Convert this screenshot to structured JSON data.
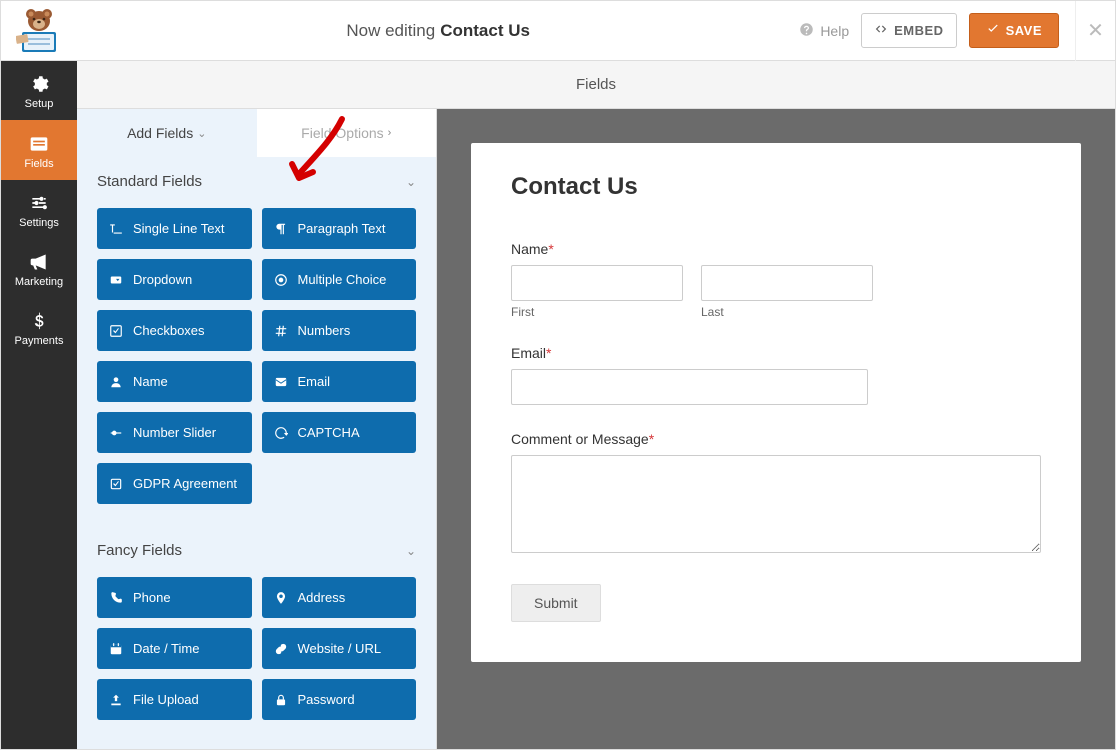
{
  "header": {
    "editing_prefix": "Now editing",
    "form_name": "Contact Us",
    "help_label": "Help",
    "embed_label": "EMBED",
    "save_label": "SAVE"
  },
  "sidenav": {
    "items": [
      {
        "id": "setup",
        "label": "Setup"
      },
      {
        "id": "fields",
        "label": "Fields"
      },
      {
        "id": "settings",
        "label": "Settings"
      },
      {
        "id": "marketing",
        "label": "Marketing"
      },
      {
        "id": "payments",
        "label": "Payments"
      }
    ],
    "active": "fields"
  },
  "stage_title": "Fields",
  "panel_tabs": {
    "add": "Add Fields",
    "options": "Field Options"
  },
  "sections": [
    {
      "title": "Standard Fields",
      "items": [
        {
          "icon": "text-line",
          "label": "Single Line Text"
        },
        {
          "icon": "paragraph",
          "label": "Paragraph Text"
        },
        {
          "icon": "dropdown",
          "label": "Dropdown"
        },
        {
          "icon": "radio",
          "label": "Multiple Choice"
        },
        {
          "icon": "checkbox",
          "label": "Checkboxes"
        },
        {
          "icon": "hash",
          "label": "Numbers"
        },
        {
          "icon": "user",
          "label": "Name"
        },
        {
          "icon": "mail",
          "label": "Email"
        },
        {
          "icon": "slider",
          "label": "Number Slider"
        },
        {
          "icon": "captcha",
          "label": "CAPTCHA"
        },
        {
          "icon": "gdpr",
          "label": "GDPR Agreement"
        }
      ]
    },
    {
      "title": "Fancy Fields",
      "items": [
        {
          "icon": "phone",
          "label": "Phone"
        },
        {
          "icon": "pin",
          "label": "Address"
        },
        {
          "icon": "calendar",
          "label": "Date / Time"
        },
        {
          "icon": "link",
          "label": "Website / URL"
        },
        {
          "icon": "upload",
          "label": "File Upload"
        },
        {
          "icon": "lock",
          "label": "Password"
        }
      ]
    }
  ],
  "preview": {
    "title": "Contact Us",
    "name_label": "Name",
    "first_sub": "First",
    "last_sub": "Last",
    "email_label": "Email",
    "comment_label": "Comment or Message",
    "submit_label": "Submit"
  },
  "colors": {
    "accent_orange": "#e27730",
    "button_blue": "#0e6cad",
    "sidebar_dark": "#2d2d2d"
  }
}
